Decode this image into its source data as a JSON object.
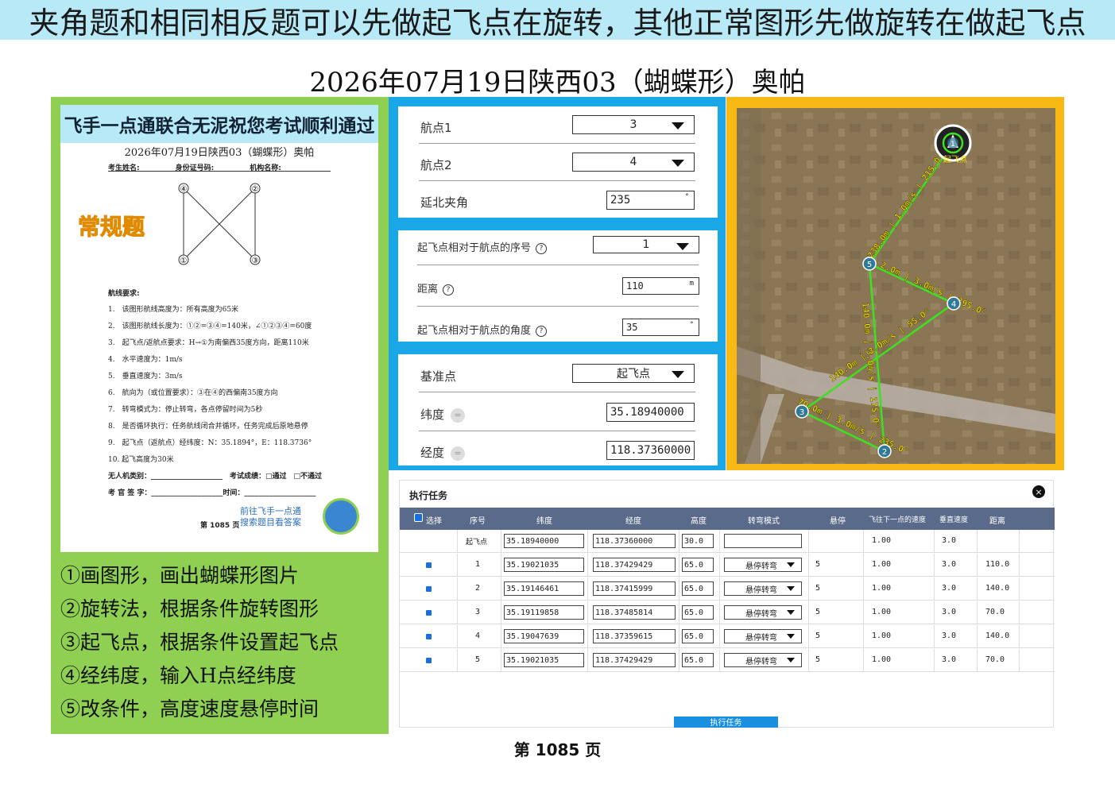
{
  "banner": "夹角题和相同相反题可以先做起飞点在旋转，其他正常图形先做旋转在做起飞点",
  "main_title": "2026年07月19日陕西03（蝴蝶形）奥帕",
  "paper": {
    "header": "飞手一点通联合无泥祝您考试顺利通过",
    "subtitle": "2026年07月19日陕西03（蝴蝶形）奥帕",
    "fields": "考生姓名:　　　　　身份证号码:　　　　　机构名称:",
    "diagram_labels": [
      "④",
      "②",
      "①",
      "③"
    ],
    "badge": "常规题",
    "req_title": "航线要求:",
    "requirements": [
      "1.　该图形航线高度为：所有高度为65米",
      "2.　该图形航线长度为：①②=③④=140米，∠①②③④=60度",
      "3.　起飞点/返航点要求：H→①为南偏西35度方向，距离110米",
      "4.　水平速度为：1m/s",
      "5.　垂直速度为：3m/s",
      "6.　航向为（或位置要求）：③在④的西偏南35度方向",
      "7.　转弯模式为：停止转弯，各点停留时间为5秒",
      "8.　是否循环执行：任务航线闭合并循环，任务完成后原地悬停",
      "9.　起飞点（返航点）经纬度：N：35.1894°，E：118.3736°",
      "10. 起飞高度为30米"
    ],
    "sign1": "无人机类别：____________________　考试成绩：□通过　□不通过",
    "sign2": "考 官 签 字：____________________时间：____________________",
    "promo1": "前往飞手一点通",
    "promo2": "搜索题目看答案",
    "page_small": "第 1085 页"
  },
  "steps": [
    "①画图形，画出蝴蝶形图片",
    "②旋转法，根据条件旋转图形",
    "③起飞点，根据条件设置起飞点",
    "④经纬度，输入H点经纬度",
    "⑤改条件，高度速度悬停时间"
  ],
  "panel1": {
    "wp1_label": "航点1",
    "wp1_value": "3",
    "wp2_label": "航点2",
    "wp2_value": "4",
    "angle_label": "延北夹角",
    "angle_value": "235",
    "angle_unit": "°"
  },
  "panel2": {
    "seq_label": "起飞点相对于航点的序号",
    "seq_value": "1",
    "dist_label": "距离",
    "dist_value": "110",
    "dist_unit": "m",
    "ang_label": "起飞点相对于航点的角度",
    "ang_value": "35",
    "ang_unit": "°",
    "help": "?"
  },
  "panel3": {
    "ref_label": "基准点",
    "ref_value": "起飞点",
    "lat_label": "纬度",
    "lat_value": "35.18940000",
    "lon_label": "经度",
    "lon_value": "118.37360000",
    "eq": "="
  },
  "map": {
    "home_label": "起飞点",
    "waypoints": [
      "1",
      "2",
      "3",
      "4",
      "5"
    ],
    "segments": [
      "238.0m | 1.0m/s | 215.0°",
      "2.0m | 3.0m/s | 295.0°",
      "140.0m | 3.0m/s | 55.0°",
      "140.0m | 3.0m/s | 175.0°",
      "70.0m | 3.0m/s | 235.0°"
    ],
    "colors": {
      "route": "#3ee01f",
      "wp_fill": "#2f7a96"
    }
  },
  "table": {
    "title": "执行任务",
    "close": "×",
    "headers": [
      "选择",
      "序号",
      "纬度",
      "经度",
      "高度",
      "转弯模式",
      "悬停",
      "飞往下一点的速度",
      "垂直速度",
      "距离"
    ],
    "rows": [
      {
        "seq": "起飞点",
        "lat": "35.18940000",
        "lon": "118.37360000",
        "alt": "30.0",
        "mode": "",
        "hover": "",
        "speed": "1.00",
        "vspeed": "3.0",
        "dist": ""
      },
      {
        "seq": "1",
        "lat": "35.19021035",
        "lon": "118.37429429",
        "alt": "65.0",
        "mode": "悬停转弯",
        "hover": "5",
        "speed": "1.00",
        "vspeed": "3.0",
        "dist": "110.0"
      },
      {
        "seq": "2",
        "lat": "35.19146461",
        "lon": "118.37415999",
        "alt": "65.0",
        "mode": "悬停转弯",
        "hover": "5",
        "speed": "1.00",
        "vspeed": "3.0",
        "dist": "140.0"
      },
      {
        "seq": "3",
        "lat": "35.19119858",
        "lon": "118.37485814",
        "alt": "65.0",
        "mode": "悬停转弯",
        "hover": "5",
        "speed": "1.00",
        "vspeed": "3.0",
        "dist": "70.0"
      },
      {
        "seq": "4",
        "lat": "35.19047639",
        "lon": "118.37359615",
        "alt": "65.0",
        "mode": "悬停转弯",
        "hover": "5",
        "speed": "1.00",
        "vspeed": "3.0",
        "dist": "140.0"
      },
      {
        "seq": "5",
        "lat": "35.19021035",
        "lon": "118.37429429",
        "alt": "65.0",
        "mode": "悬停转弯",
        "hover": "5",
        "speed": "1.00",
        "vspeed": "3.0",
        "dist": "70.0"
      }
    ],
    "exec_label": "执行任务"
  },
  "footer": "第 1085 页"
}
